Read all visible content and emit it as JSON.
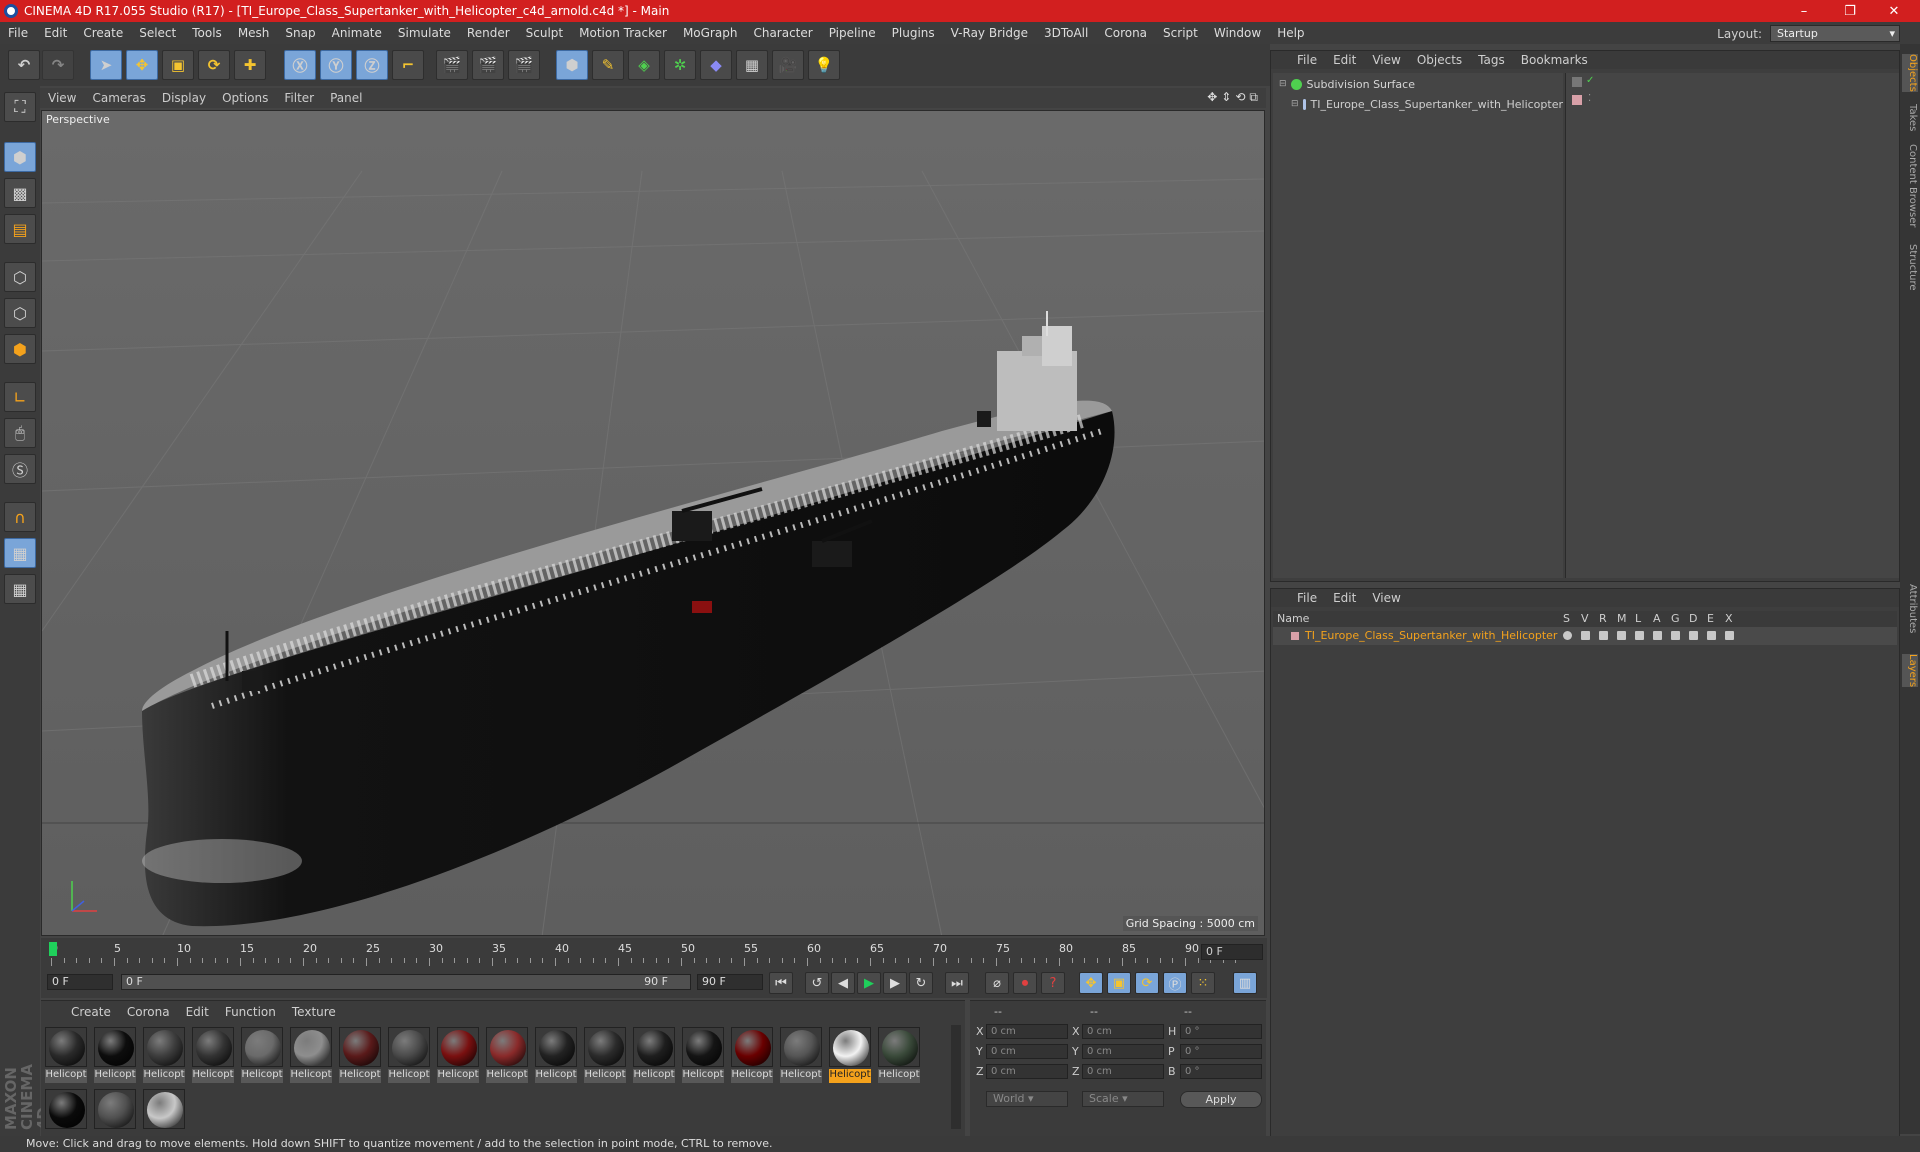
{
  "window": {
    "title": "CINEMA 4D R17.055 Studio (R17) - [TI_Europe_Class_Supertanker_with_Helicopter_c4d_arnold.c4d *] - Main",
    "minimize": "–",
    "restore": "❐",
    "close": "✕"
  },
  "menubar": {
    "items": [
      "File",
      "Edit",
      "Create",
      "Select",
      "Tools",
      "Mesh",
      "Snap",
      "Animate",
      "Simulate",
      "Render",
      "Sculpt",
      "Motion Tracker",
      "MoGraph",
      "Character",
      "Pipeline",
      "Plugins",
      "V-Ray Bridge",
      "3DToAll",
      "Corona",
      "Script",
      "Window",
      "Help"
    ],
    "layout_label": "Layout:",
    "layout_value": "Startup"
  },
  "viewport": {
    "menu": [
      "View",
      "Cameras",
      "Display",
      "Options",
      "Filter",
      "Panel"
    ],
    "label": "Perspective",
    "grid_spacing": "Grid Spacing : 5000 cm"
  },
  "timeline": {
    "ticks": [
      "0",
      "5",
      "10",
      "15",
      "20",
      "25",
      "30",
      "35",
      "40",
      "45",
      "50",
      "55",
      "60",
      "65",
      "70",
      "75",
      "80",
      "85",
      "90"
    ],
    "current_frame": "0 F"
  },
  "transport": {
    "start_frame": "0 F",
    "range_start": "0 F",
    "range_end": "90 F",
    "end_frame": "90 F"
  },
  "materials": {
    "menu": [
      "Create",
      "Corona",
      "Edit",
      "Function",
      "Texture"
    ],
    "items": [
      {
        "label": "Helicopt",
        "color": "#2a2a2a",
        "selected": false
      },
      {
        "label": "Helicopt",
        "color": "#0d0d0d",
        "selected": false
      },
      {
        "label": "Helicopt",
        "color": "#3d3d3d",
        "selected": false
      },
      {
        "label": "Helicopt",
        "color": "#333333",
        "selected": false
      },
      {
        "label": "Helicopt",
        "color": "#6a6a6a",
        "selected": false
      },
      {
        "label": "Helicopt",
        "color": "#8e8e8e",
        "selected": false
      },
      {
        "label": "Helicopt",
        "color": "#5a1a1a",
        "selected": false
      },
      {
        "label": "Helicopt",
        "color": "#4a4a4a",
        "selected": false
      },
      {
        "label": "Helicopt",
        "color": "#7a1010",
        "selected": false
      },
      {
        "label": "Helicopt",
        "color": "#8a2a2a",
        "selected": false
      },
      {
        "label": "Helicopt",
        "color": "#222222",
        "selected": false
      },
      {
        "label": "Helicopt",
        "color": "#2b2b2b",
        "selected": false
      },
      {
        "label": "Helicopt",
        "color": "#1e1e1e",
        "selected": false
      },
      {
        "label": "Helicopt",
        "color": "#151515",
        "selected": false
      },
      {
        "label": "Helicopt",
        "color": "#6a0000",
        "selected": false
      },
      {
        "label": "Helicopt",
        "color": "#555555",
        "selected": false
      },
      {
        "label": "Helicopt",
        "color": "#f2f2f2",
        "selected": true
      },
      {
        "label": "Helicopt",
        "color": "#3a4a3a",
        "selected": false
      },
      {
        "label": "",
        "color": "#0a0a0a",
        "selected": false
      },
      {
        "label": "",
        "color": "#505050",
        "selected": false
      },
      {
        "label": "",
        "color": "#c8c8c8",
        "selected": false
      }
    ]
  },
  "coords": {
    "head": [
      "--",
      "--",
      "--"
    ],
    "rows": [
      {
        "a": "X",
        "av": "0 cm",
        "b": "X",
        "bv": "0 cm",
        "c": "H",
        "cv": "0 °"
      },
      {
        "a": "Y",
        "av": "0 cm",
        "b": "Y",
        "bv": "0 cm",
        "c": "P",
        "cv": "0 °"
      },
      {
        "a": "Z",
        "av": "0 cm",
        "b": "Z",
        "bv": "0 cm",
        "c": "B",
        "cv": "0 °"
      }
    ],
    "world": "World",
    "scale": "Scale",
    "apply": "Apply"
  },
  "objects": {
    "menu": [
      "File",
      "Edit",
      "View",
      "Objects",
      "Tags",
      "Bookmarks"
    ],
    "items": [
      {
        "name": "Subdivision Surface",
        "color": "#d6d6d6"
      },
      {
        "name": "TI_Europe_Class_Supertanker_with_Helicopter",
        "color": "#cfcfcf"
      }
    ]
  },
  "layers": {
    "menu": [
      "File",
      "Edit",
      "View"
    ],
    "head_name": "Name",
    "flags": [
      "S",
      "V",
      "R",
      "M",
      "L",
      "A",
      "G",
      "D",
      "E",
      "X"
    ],
    "row_name": "TI_Europe_Class_Supertanker_with_Helicopter",
    "row_color": "#f4a21c"
  },
  "right_tabs": [
    "Objects",
    "Takes",
    "Content Browser",
    "Structure",
    "Attributes",
    "Layers"
  ],
  "status": "Move: Click and drag to move elements. Hold down SHIFT to quantize movement / add to the selection in point mode, CTRL to remove.",
  "brand": "MAXON CINEMA 4D"
}
